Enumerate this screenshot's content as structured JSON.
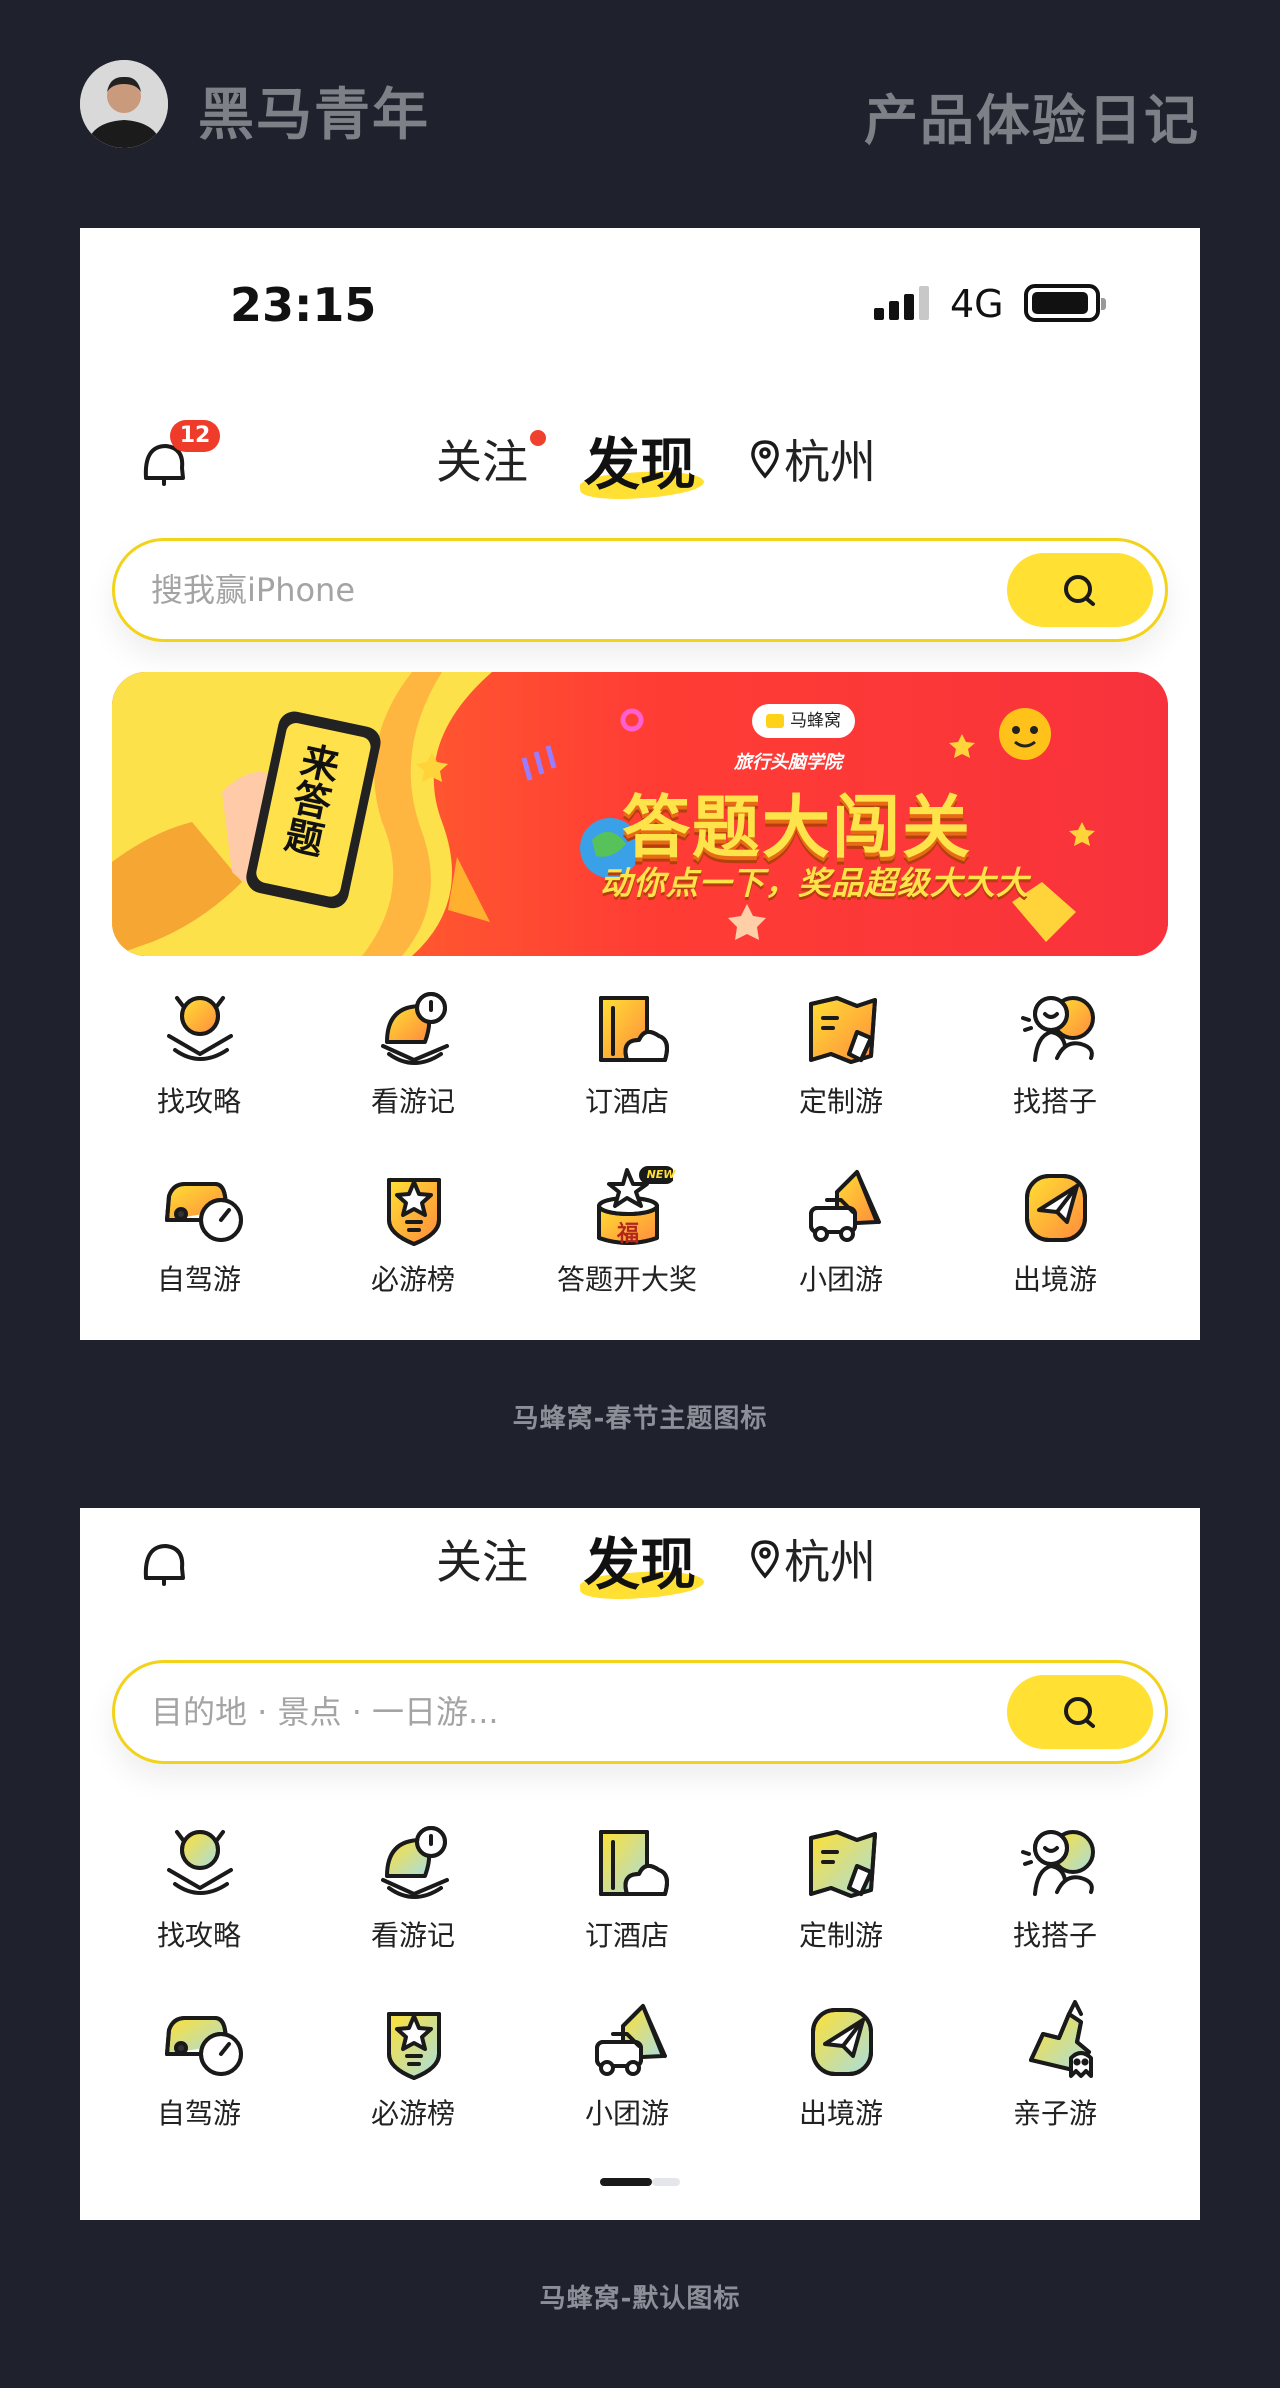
{
  "header": {
    "author": "黑马青年",
    "title": "产品体验日记"
  },
  "spring": {
    "status": {
      "time": "23:15",
      "network": "4G"
    },
    "nav": {
      "badge": "12",
      "tab_follow": "关注",
      "tab_discover": "发现",
      "city": "杭州"
    },
    "search_placeholder": "搜我赢iPhone",
    "banner": {
      "phone_text": "来答题",
      "logo": "马蜂窝",
      "subtitle": "旅行头脑学院",
      "title": "答题大闯关",
      "slogan": "动你点一下，奖品超级大大大"
    },
    "icons": [
      {
        "label": "找攻略",
        "icon": "guide-icon"
      },
      {
        "label": "看游记",
        "icon": "travelogue-icon"
      },
      {
        "label": "订酒店",
        "icon": "hotel-icon"
      },
      {
        "label": "定制游",
        "icon": "custom-tour-icon"
      },
      {
        "label": "找搭子",
        "icon": "buddy-icon"
      },
      {
        "label": "自驾游",
        "icon": "self-drive-icon"
      },
      {
        "label": "必游榜",
        "icon": "ranking-icon"
      },
      {
        "label": "答题开大奖",
        "icon": "quiz-prize-icon",
        "new_badge": "NEW",
        "fu": "福"
      },
      {
        "label": "小团游",
        "icon": "small-group-icon"
      },
      {
        "label": "出境游",
        "icon": "outbound-icon"
      }
    ],
    "caption": "马蜂窝-春节主题图标"
  },
  "default": {
    "nav": {
      "tab_follow": "关注",
      "tab_discover": "发现",
      "city": "杭州"
    },
    "search_placeholder": "目的地 · 景点 · 一日游...",
    "icons": [
      {
        "label": "找攻略",
        "icon": "guide-icon"
      },
      {
        "label": "看游记",
        "icon": "travelogue-icon"
      },
      {
        "label": "订酒店",
        "icon": "hotel-icon"
      },
      {
        "label": "定制游",
        "icon": "custom-tour-icon"
      },
      {
        "label": "找搭子",
        "icon": "buddy-icon"
      },
      {
        "label": "自驾游",
        "icon": "self-drive-icon"
      },
      {
        "label": "必游榜",
        "icon": "ranking-icon"
      },
      {
        "label": "小团游",
        "icon": "small-group-icon"
      },
      {
        "label": "出境游",
        "icon": "outbound-icon"
      },
      {
        "label": "亲子游",
        "icon": "family-tour-icon"
      }
    ],
    "caption": "马蜂窝-默认图标"
  },
  "colors": {
    "background": "#1f222c",
    "accent_yellow": "#ffe033",
    "accent_red": "#ef3b2a",
    "gradient_orange": "#ff8a3d",
    "gradient_teal": "#a8dde0"
  }
}
